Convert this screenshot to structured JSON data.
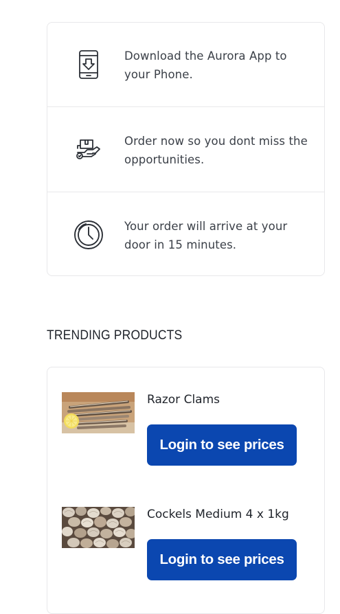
{
  "features": [
    {
      "icon": "phone-download-icon",
      "text": "Download the Aurora App to your Phone."
    },
    {
      "icon": "delivery-box-icon",
      "text": "Order now so you dont miss the opportunities."
    },
    {
      "icon": "clock-icon",
      "text": "Your order will arrive at your door in 15 minutes."
    }
  ],
  "trending": {
    "title": "TRENDING PRODUCTS",
    "products": [
      {
        "name": "Razor Clams",
        "image": "razor-clams-image",
        "button_label": "Login to see prices"
      },
      {
        "name": "Cockels Medium 4 x 1kg",
        "image": "cockles-image",
        "button_label": "Login to see prices"
      }
    ]
  },
  "colors": {
    "accent": "#0b47b0",
    "text": "#3b4048",
    "border": "#e8e8ea"
  }
}
